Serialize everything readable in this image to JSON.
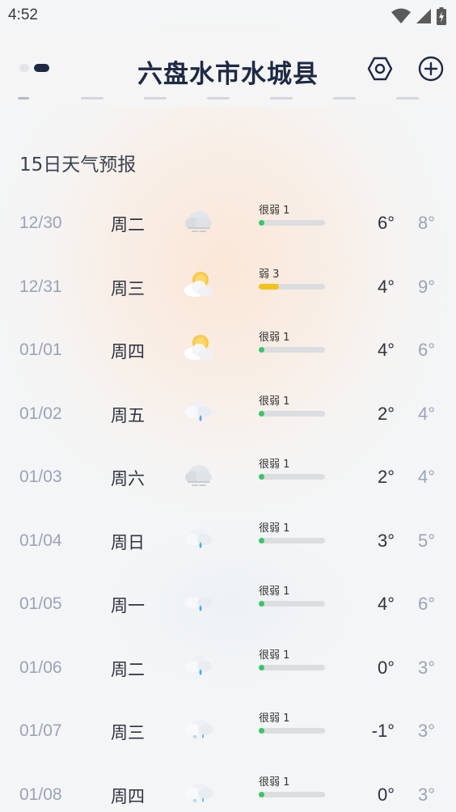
{
  "status_bar": {
    "time": "4:52",
    "icons": [
      "wifi-icon",
      "signal-icon",
      "battery-charging-icon"
    ]
  },
  "header": {
    "city": "六盘水市水城县",
    "page_indicator": {
      "count": 2,
      "active": 1
    },
    "settings_icon": "hexagon-settings-icon",
    "add_icon": "plus-circle-icon"
  },
  "forecast": {
    "title": "15日天气预报",
    "days": [
      {
        "date": "12/30",
        "weekday": "周二",
        "icon": "haze-cloud",
        "aqi_label": "很弱 1",
        "aqi_level": 0.05,
        "aqi_color": "#3cc46b",
        "low": "6°",
        "high": "8°"
      },
      {
        "date": "12/31",
        "weekday": "周三",
        "icon": "sun-cloud",
        "aqi_label": "弱 3",
        "aqi_level": 0.3,
        "aqi_color": "#f2c21b",
        "low": "4°",
        "high": "9°"
      },
      {
        "date": "01/01",
        "weekday": "周四",
        "icon": "sun-cloud",
        "aqi_label": "很弱 1",
        "aqi_level": 0.05,
        "aqi_color": "#3cc46b",
        "low": "4°",
        "high": "6°"
      },
      {
        "date": "01/02",
        "weekday": "周五",
        "icon": "rain-cloud",
        "aqi_label": "很弱 1",
        "aqi_level": 0.05,
        "aqi_color": "#3cc46b",
        "low": "2°",
        "high": "4°"
      },
      {
        "date": "01/03",
        "weekday": "周六",
        "icon": "haze-cloud",
        "aqi_label": "很弱 1",
        "aqi_level": 0.05,
        "aqi_color": "#3cc46b",
        "low": "2°",
        "high": "4°"
      },
      {
        "date": "01/04",
        "weekday": "周日",
        "icon": "rain-cloud",
        "aqi_label": "很弱 1",
        "aqi_level": 0.05,
        "aqi_color": "#3cc46b",
        "low": "3°",
        "high": "5°"
      },
      {
        "date": "01/05",
        "weekday": "周一",
        "icon": "rain-cloud",
        "aqi_label": "很弱 1",
        "aqi_level": 0.05,
        "aqi_color": "#3cc46b",
        "low": "4°",
        "high": "6°"
      },
      {
        "date": "01/06",
        "weekday": "周二",
        "icon": "rain-cloud",
        "aqi_label": "很弱 1",
        "aqi_level": 0.05,
        "aqi_color": "#3cc46b",
        "low": "0°",
        "high": "3°"
      },
      {
        "date": "01/07",
        "weekday": "周三",
        "icon": "sleet-cloud",
        "aqi_label": "很弱 1",
        "aqi_level": 0.05,
        "aqi_color": "#3cc46b",
        "low": "-1°",
        "high": "3°"
      },
      {
        "date": "01/08",
        "weekday": "周四",
        "icon": "sleet-cloud",
        "aqi_label": "很弱 1",
        "aqi_level": 0.05,
        "aqi_color": "#3cc46b",
        "low": "0°",
        "high": "3°"
      }
    ]
  }
}
